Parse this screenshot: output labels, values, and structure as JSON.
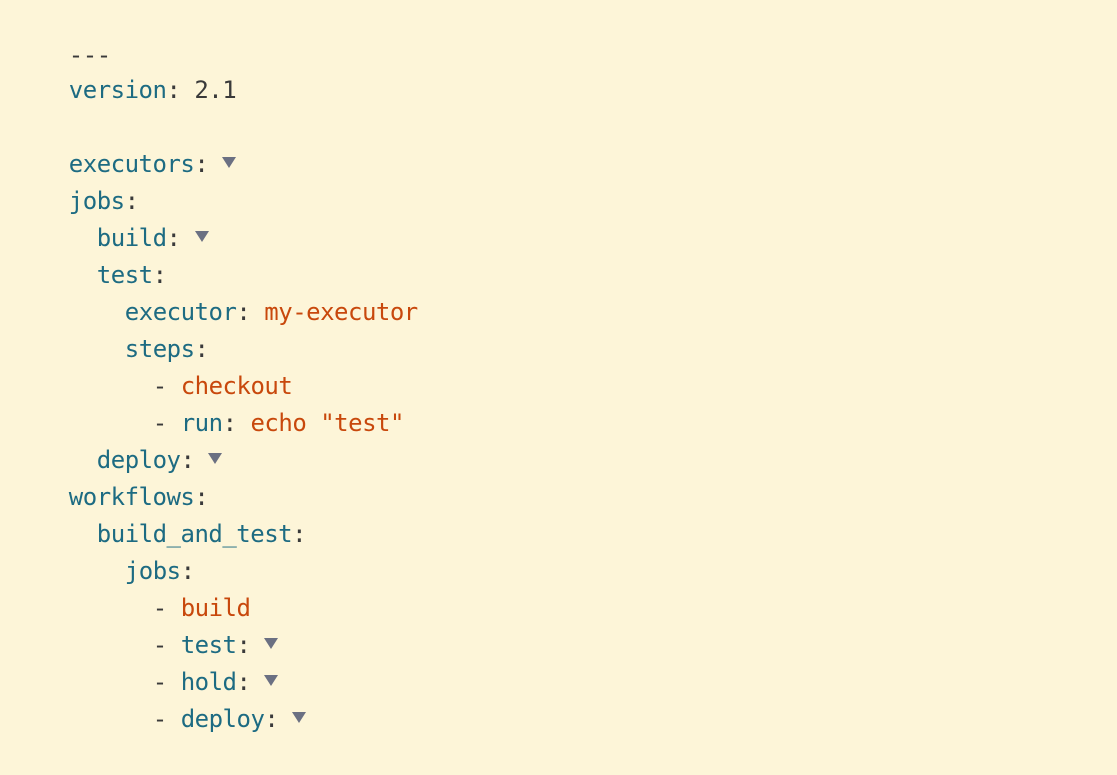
{
  "lines": {
    "doc_start": "---",
    "version_key": "version",
    "version_val": "2.1",
    "executors_key": "executors",
    "jobs_key": "jobs",
    "build_key": "build",
    "test_key": "test",
    "executor_key": "executor",
    "executor_val": "my-executor",
    "steps_key": "steps",
    "checkout_val": "checkout",
    "run_key": "run",
    "run_val": "echo \"test\"",
    "deploy_key": "deploy",
    "workflows_key": "workflows",
    "build_and_test_key": "build_and_test",
    "wf_jobs_key": "jobs",
    "wf_build_val": "build",
    "wf_test_key": "test",
    "wf_hold_key": "hold",
    "wf_deploy_key": "deploy"
  },
  "symbols": {
    "colon": ":",
    "dash": "- "
  },
  "icons": {
    "fold": "fold-toggle-icon"
  },
  "colors": {
    "background": "#fdf5d8",
    "key": "#1d6b82",
    "string": "#c8480c",
    "fold": "#6b7082"
  }
}
